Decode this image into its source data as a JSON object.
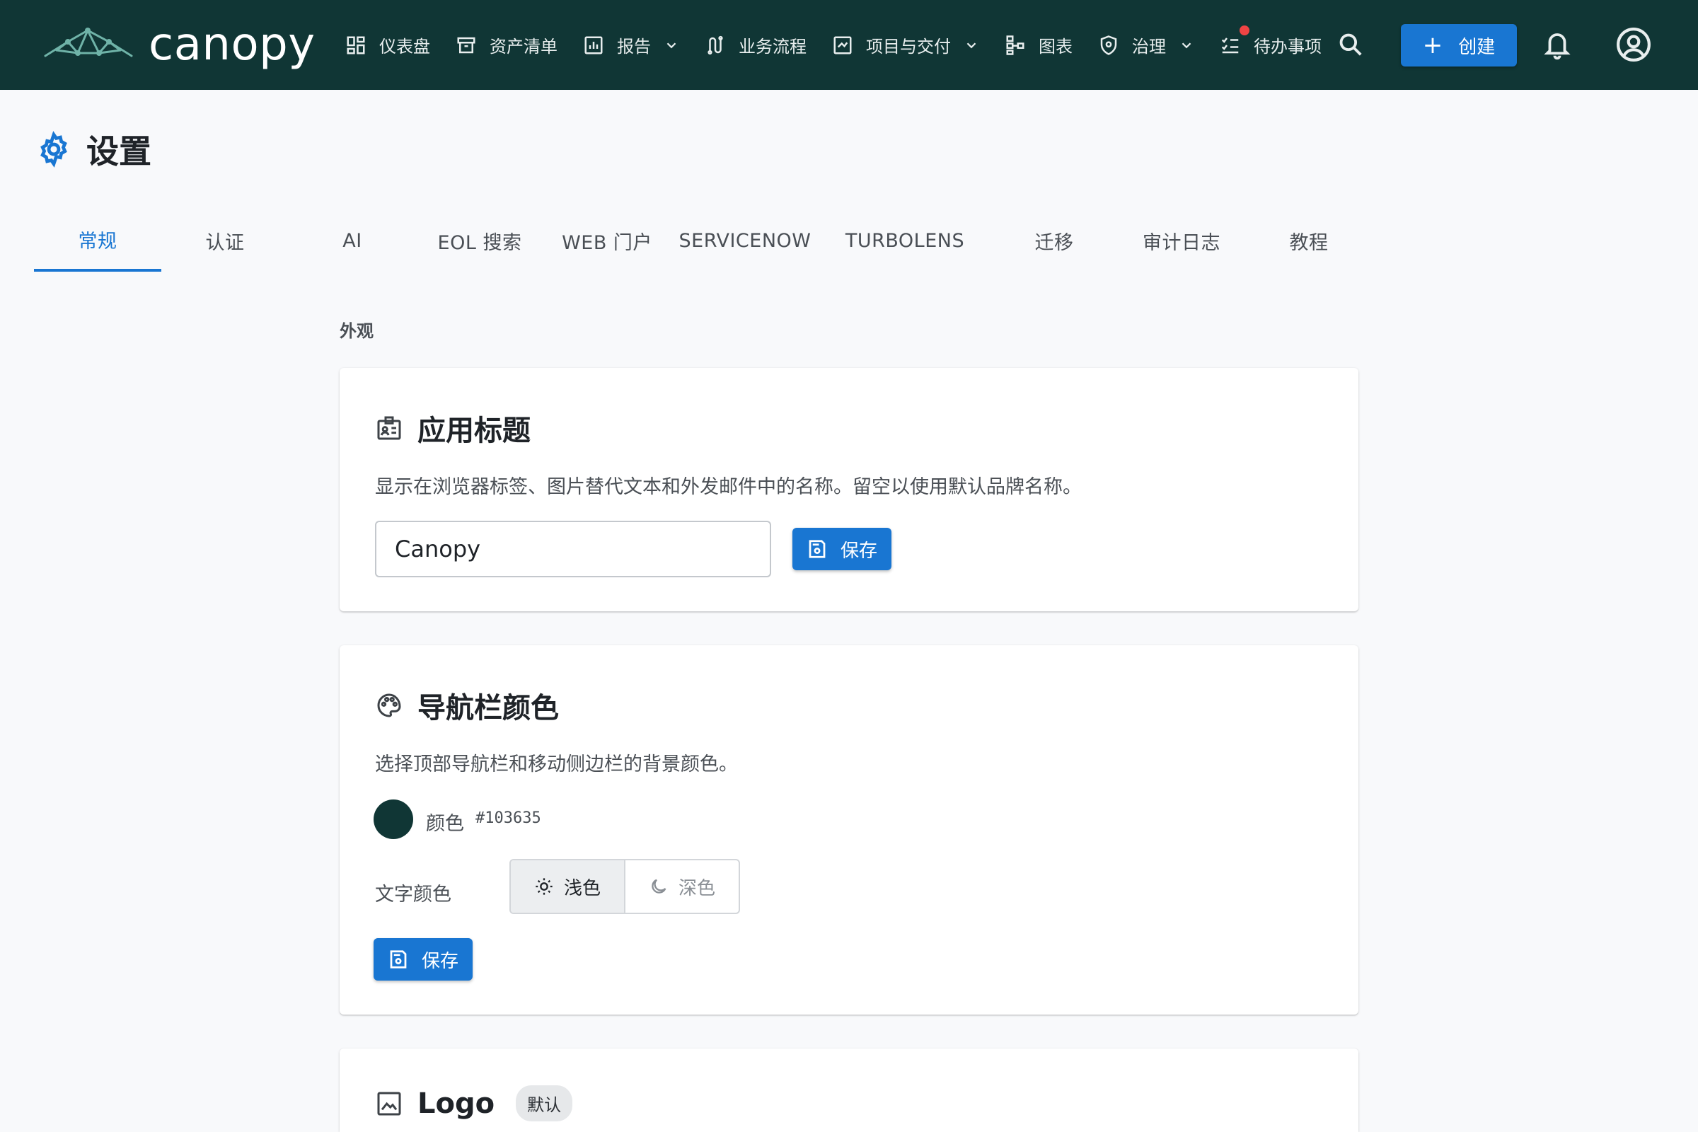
{
  "app": {
    "name": "canopy"
  },
  "nav": {
    "items": [
      {
        "label": "仪表盘",
        "icon": "dashboard-icon"
      },
      {
        "label": "资产清单",
        "icon": "archive-icon"
      },
      {
        "label": "报告",
        "icon": "report-chart-icon",
        "dropdown": true
      },
      {
        "label": "业务流程",
        "icon": "workflow-icon"
      },
      {
        "label": "项目与交付",
        "icon": "project-icon",
        "dropdown": true
      },
      {
        "label": "图表",
        "icon": "diagram-icon"
      },
      {
        "label": "治理",
        "icon": "shield-icon",
        "dropdown": true
      },
      {
        "label": "待办事项",
        "icon": "checklist-icon",
        "notification": true
      }
    ],
    "create_label": "创建"
  },
  "page": {
    "title": "设置"
  },
  "tabs": [
    {
      "label": "常规",
      "active": true
    },
    {
      "label": "认证"
    },
    {
      "label": "AI"
    },
    {
      "label": "EOL 搜索"
    },
    {
      "label": "WEB 门户"
    },
    {
      "label": "SERVICENOW"
    },
    {
      "label": "TURBOLENS"
    },
    {
      "label": "迁移"
    },
    {
      "label": "审计日志"
    },
    {
      "label": "教程"
    }
  ],
  "section": {
    "label": "外观"
  },
  "app_title_card": {
    "title": "应用标题",
    "description": "显示在浏览器标签、图片替代文本和外发邮件中的名称。留空以使用默认品牌名称。",
    "input_value": "Canopy",
    "save_label": "保存"
  },
  "navbar_color_card": {
    "title": "导航栏颜色",
    "description": "选择顶部导航栏和移动侧边栏的背景颜色。",
    "color_label": "颜色",
    "color_hex": "#103635",
    "text_color_label": "文字颜色",
    "light_label": "浅色",
    "dark_label": "深色",
    "selected": "light",
    "save_label": "保存"
  },
  "logo_card": {
    "title": "Logo",
    "badge": "默认"
  },
  "colors": {
    "navbar": "#103635",
    "accent": "#1976d2",
    "notification": "#ef4444"
  }
}
